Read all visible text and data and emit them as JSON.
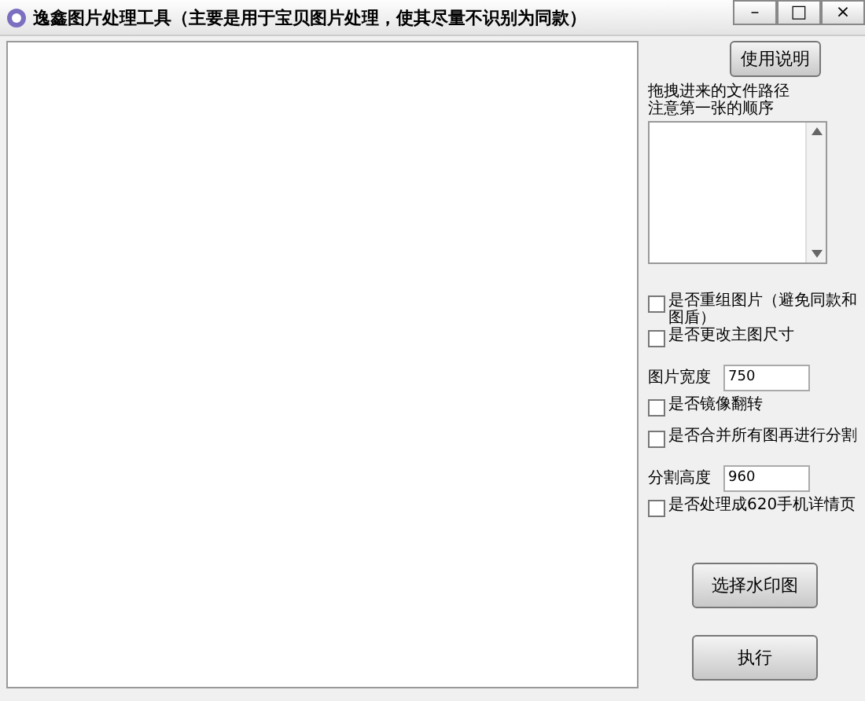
{
  "window": {
    "title": "逸鑫图片处理工具（主要是用于宝贝图片处理，使其尽量不识别为同款）",
    "controls": [
      "–",
      "□",
      "×"
    ]
  },
  "help_button": "使用说明",
  "file_list": {
    "caption_lines": [
      "拖拽进来的文件路径",
      "注意第一张的顺序"
    ]
  },
  "options": [
    {
      "kind": "checkbox",
      "label": "是否重组图片（避免同款和图盾）",
      "checked": false
    },
    {
      "kind": "checkbox",
      "label": "是否更改主图尺寸",
      "checked": false
    },
    {
      "kind": "field",
      "label": "图片宽度",
      "value": "750"
    },
    {
      "kind": "checkbox",
      "label": "是否镜像翻转",
      "checked": false
    },
    {
      "kind": "checkbox",
      "label": "是否合并所有图再进行分割",
      "checked": false
    },
    {
      "kind": "field",
      "label": "分割高度",
      "value": "960"
    },
    {
      "kind": "checkbox",
      "label": "是否处理成620手机详情页",
      "checked": false
    }
  ],
  "buttons": [
    "选择水印图",
    "执行"
  ]
}
